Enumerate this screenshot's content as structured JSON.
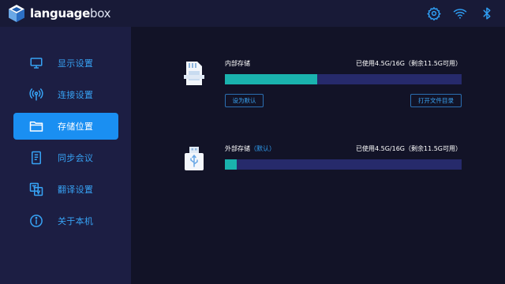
{
  "app": {
    "logo_bold": "language",
    "logo_light": "box"
  },
  "topbar": {
    "icons": [
      "settings-gear-icon",
      "wifi-icon",
      "bluetooth-icon"
    ]
  },
  "sidebar": {
    "items": [
      {
        "label": "显示设置",
        "icon": "monitor-icon",
        "active": false
      },
      {
        "label": "连接设置",
        "icon": "broadcast-icon",
        "active": false
      },
      {
        "label": "存储位置",
        "icon": "folder-icon",
        "active": true
      },
      {
        "label": "同步会议",
        "icon": "tablet-icon",
        "active": false
      },
      {
        "label": "翻译设置",
        "icon": "translate-icon",
        "active": false
      },
      {
        "label": "关于本机",
        "icon": "info-icon",
        "active": false
      }
    ]
  },
  "storage": {
    "internal": {
      "name": "内部存储",
      "usage": "已使用4.5G/16G（剩余11.5G可用）",
      "used_fraction": 0.39,
      "set_default_label": "设为默认",
      "open_dir_label": "打开文件目录"
    },
    "external": {
      "name": "外部存储",
      "tag": "（默认）",
      "usage": "已使用4.5G/16G（剩余11.5G可用）",
      "used_fraction": 0.05
    }
  },
  "colors": {
    "accent": "#1a8ff2",
    "bar_fill": "#1ab3ae",
    "bar_track": "#262a6b",
    "sidebar_bg": "#1c1e43",
    "main_bg": "#121327"
  }
}
